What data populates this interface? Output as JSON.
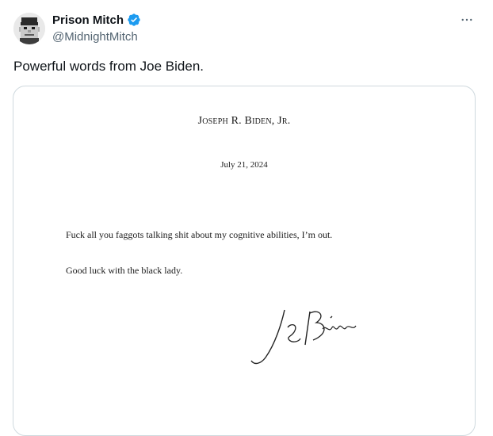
{
  "tweet": {
    "author": {
      "display_name": "Prison Mitch",
      "handle": "@MidnightMitch",
      "verified": true
    },
    "more_icon": "more-horizontal-icon",
    "text": "Powerful words from Joe Biden."
  },
  "letter": {
    "letterhead": "Joseph R. Biden, Jr.",
    "date": "July 21, 2024",
    "paragraphs": [
      "Fuck all you faggots talking shit about my cognitive abilities, I’m out.",
      "Good luck with the black lady."
    ],
    "signature": "JR Biden"
  },
  "colors": {
    "verified_badge": "#1d9bf0",
    "secondary_text": "#536471",
    "card_border": "#cfd9de"
  }
}
